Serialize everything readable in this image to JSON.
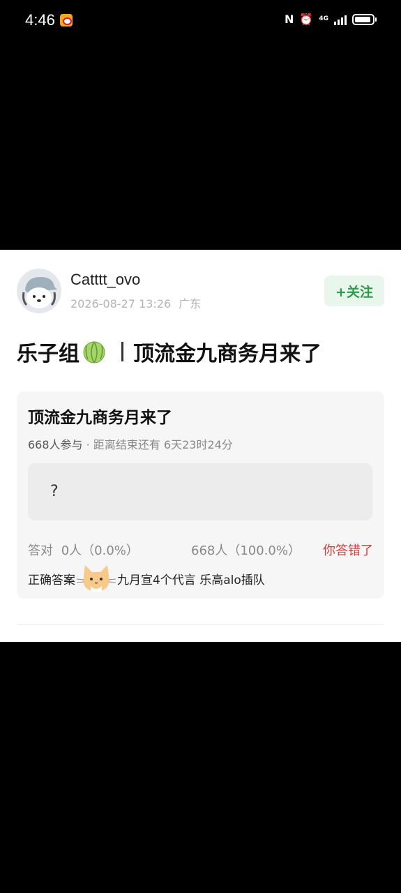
{
  "status_bar": {
    "time": "4:46",
    "network": "4G"
  },
  "post": {
    "author": "Catttt_ovo",
    "date": "2026-08-27 13:26",
    "location": "广东",
    "follow_label": "+关注",
    "title_left": "乐子组",
    "title_right": "顶流金九商务月来了"
  },
  "quiz": {
    "title": "顶流金九商务月来了",
    "participants": "668人参与",
    "ends_in": "· 距离结束还有 6天23时24分",
    "option_text": "?",
    "correct_label": "答对",
    "correct_stat": "0人（0.0%）",
    "wrong_stat": "668人（100.0%）",
    "wrong_badge": "你答错了",
    "answer_prefix": "正确答案",
    "answer_text": "九月宣4个代言 乐高alo插队"
  },
  "colors": {
    "follow_green": "#2c9a4a",
    "wrong_red": "#d23c3c"
  },
  "icons": [
    "weibo-icon",
    "nfc-icon",
    "alarm-icon",
    "signal-icon",
    "battery-icon",
    "melon-emoji-icon",
    "cat-sticker-icon"
  ]
}
